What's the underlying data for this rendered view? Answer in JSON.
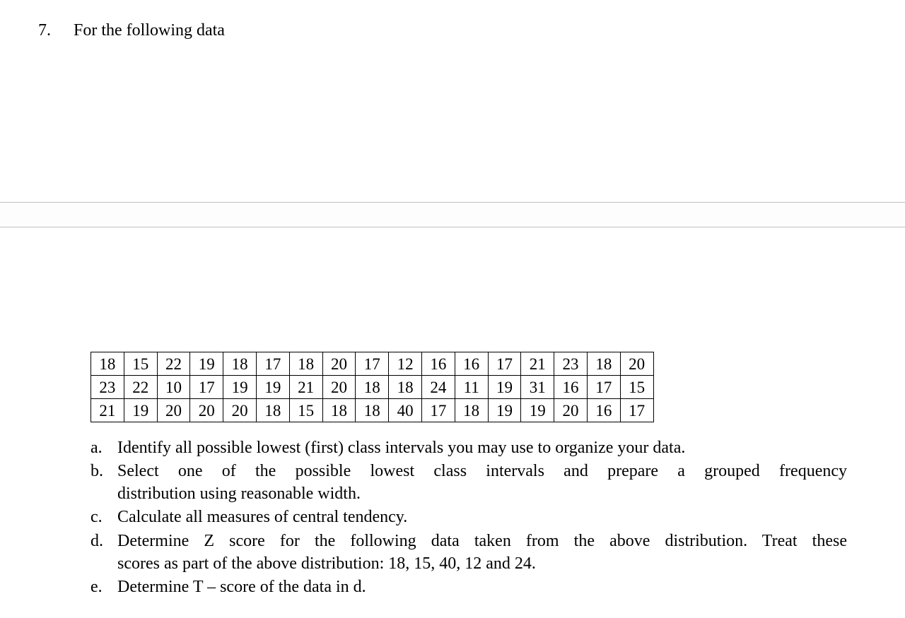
{
  "question": {
    "number": "7.",
    "prompt": "For the following data"
  },
  "table": {
    "rows": [
      [
        "18",
        "15",
        "22",
        "19",
        "18",
        "17",
        "18",
        "20",
        "17",
        "12",
        "16",
        "16",
        "17",
        "21",
        "23",
        "18",
        "20"
      ],
      [
        "23",
        "22",
        "10",
        "17",
        "19",
        "19",
        "21",
        "20",
        "18",
        "18",
        "24",
        "11",
        "19",
        "31",
        "16",
        "17",
        "15"
      ],
      [
        "21",
        "19",
        "20",
        "20",
        "20",
        "18",
        "15",
        "18",
        "18",
        "40",
        "17",
        "18",
        "19",
        "19",
        "20",
        "16",
        "17"
      ]
    ]
  },
  "subs": {
    "a": {
      "letter": "a.",
      "text": "Identify all possible lowest (first) class intervals you may use to organize your data."
    },
    "b": {
      "letter": "b.",
      "line1": "Select one of the possible lowest class intervals and prepare a grouped frequency",
      "line2": "distribution using reasonable width."
    },
    "c": {
      "letter": "c.",
      "text": "Calculate all measures of central tendency."
    },
    "d": {
      "letter": "d.",
      "line1": "Determine Z score for the following data taken from the above distribution. Treat these",
      "line2": "scores as part of the above distribution: 18, 15, 40, 12 and 24."
    },
    "e": {
      "letter": "e.",
      "text": "Determine T – score of the data in d."
    }
  }
}
